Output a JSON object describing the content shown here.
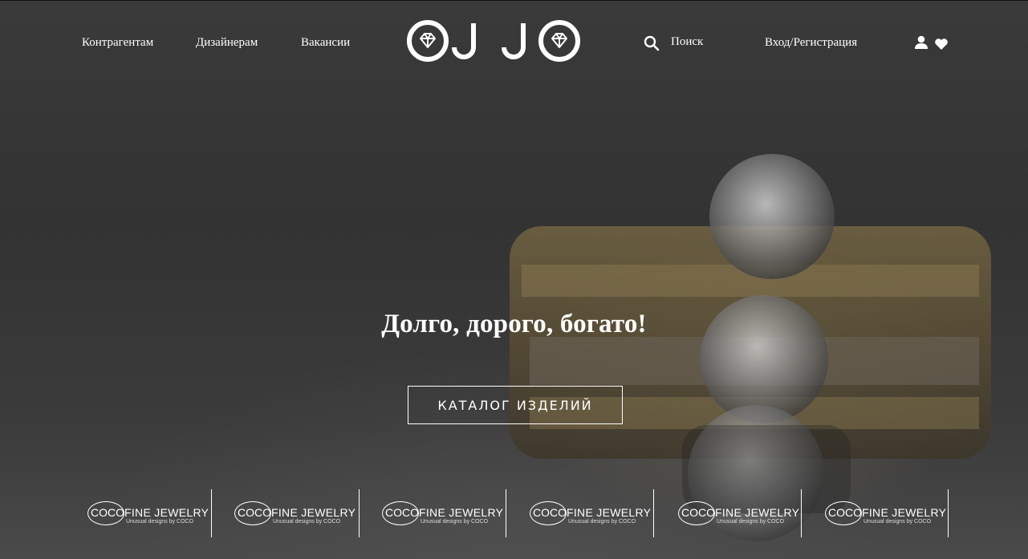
{
  "nav": {
    "left": [
      "Контрагентам",
      "Дизайнерам",
      "Вакансии"
    ],
    "search_label": "Поиск",
    "auth_label": "Вход/Регистрация"
  },
  "icons": {
    "search": "search-icon",
    "user": "user-icon",
    "wishlist": "heart-icon",
    "logo": "ojjo-logo"
  },
  "logo": {
    "letters": "OJJO"
  },
  "hero": {
    "headline": "Долго, дорого, богато!",
    "cta": "КАТАЛОГ ИЗДЕЛИЙ"
  },
  "partners": [
    {
      "mark": "COCO",
      "name": "FINE JEWELRY",
      "tagline": "Unusual designs by COCO"
    },
    {
      "mark": "COCO",
      "name": "FINE JEWELRY",
      "tagline": "Unusual designs by COCO"
    },
    {
      "mark": "COCO",
      "name": "FINE JEWELRY",
      "tagline": "Unusual designs by COCO"
    },
    {
      "mark": "COCO",
      "name": "FINE JEWELRY",
      "tagline": "Unusual designs by COCO"
    },
    {
      "mark": "COCO",
      "name": "FINE JEWELRY",
      "tagline": "Unusual designs by COCO"
    },
    {
      "mark": "COCO",
      "name": "FINE JEWELRY",
      "tagline": "Unusual designs by COCO"
    }
  ],
  "colors": {
    "overlay": "#2d2d2d",
    "text": "#ffffff",
    "gold": "#b29a62"
  }
}
